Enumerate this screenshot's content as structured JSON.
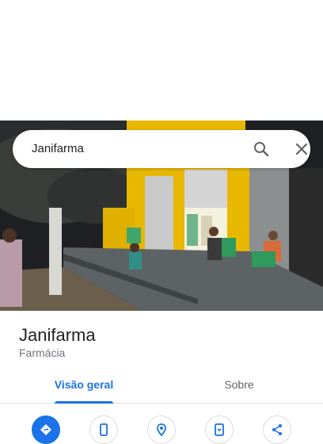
{
  "search": {
    "query": "Janifarma"
  },
  "place": {
    "name": "Janifarma",
    "category": "Farmácia"
  },
  "tabs": [
    {
      "label": "Visão geral"
    },
    {
      "label": "Sobre"
    }
  ],
  "actions": [
    {
      "icon": "directions-icon"
    },
    {
      "icon": "phone-icon"
    },
    {
      "icon": "location-pin-icon"
    },
    {
      "icon": "save-to-phone-icon"
    },
    {
      "icon": "share-icon"
    }
  ],
  "colors": {
    "accent": "#1a73e8",
    "storefront": "#f2c200"
  }
}
